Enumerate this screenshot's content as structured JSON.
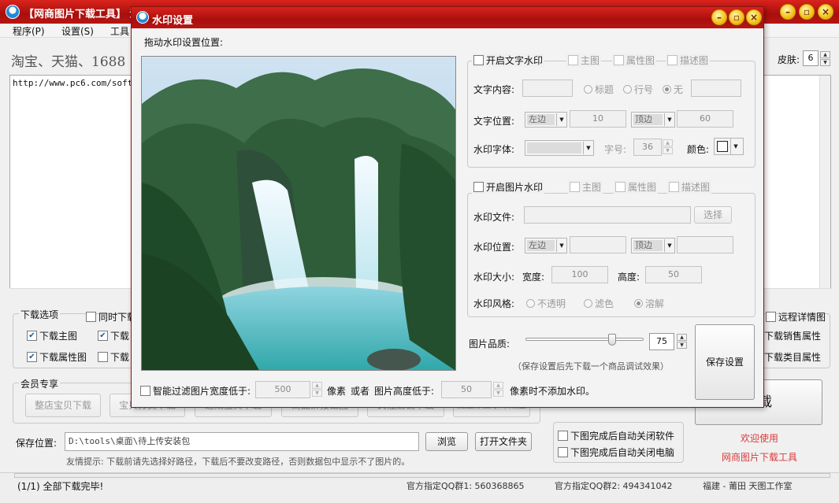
{
  "main": {
    "title": "【网商图片下载工具】 淘宝",
    "menu": [
      "程序(P)",
      "设置(S)",
      "工具"
    ],
    "slogan": "淘宝、天猫、1688",
    "url": "http://www.pc6.com/softvi",
    "skin_label": "皮肤:",
    "skin_value": "6",
    "download_options": {
      "title": "下载选项",
      "items": [
        "同时下载",
        "下载主图",
        "下载",
        "下载属性图",
        "下载"
      ],
      "right_items": [
        "远程详情图",
        "下载销售属性",
        "下载类目属性"
      ]
    },
    "member": {
      "title": "会员专享",
      "buttons": [
        "整店宝贝下载",
        "宝贝分类下载",
        "近期宝贝下载",
        "商品拼接截图",
        "关注店铺下载",
        "批量添加水印效应"
      ]
    },
    "save_label": "保存位置:",
    "save_path": "D:\\tools\\桌面\\待上传安装包",
    "browse": "浏览",
    "open_folder": "打开文件夹",
    "tip": "友情提示: 下载前请先选择好路径，下载后不要改变路径，否则数据包中显示不了图片的。",
    "big_download": "下载",
    "auto_close_soft": "下图完成后自动关闭软件",
    "auto_close_pc": "下图完成后自动关闭电脑",
    "welcome": "欢迎使用",
    "app_name": "网商图片下载工具",
    "status": {
      "progress": "(1/1) 全部下载完毕!",
      "qq1": "官方指定QQ群1: 560368865",
      "qq2": "官方指定QQ群2: 494341042",
      "studio": "福建 - 莆田 天图工作室"
    }
  },
  "dialog": {
    "title": "水印设置",
    "drag_hint": "拖动水印设置位置:",
    "text_wm": {
      "enable": "开启文字水印",
      "targets": [
        "主图",
        "属性图",
        "描述图"
      ],
      "content_label": "文字内容:",
      "opt_title": "标题",
      "opt_row": "行号",
      "opt_none": "无",
      "pos_label": "文字位置:",
      "h_align": "左边",
      "h_value": "10",
      "v_align": "顶边",
      "v_value": "60",
      "font_label": "水印字体:",
      "size_label": "字号:",
      "size_value": "36",
      "color_label": "颜色:"
    },
    "image_wm": {
      "enable": "开启图片水印",
      "targets": [
        "主图",
        "属性图",
        "描述图"
      ],
      "file_label": "水印文件:",
      "choose": "选择",
      "pos_label": "水印位置:",
      "h_align": "左边",
      "v_align": "顶边",
      "size_label": "水印大小:",
      "width_label": "宽度:",
      "width_value": "100",
      "height_label": "高度:",
      "height_value": "50",
      "style_label": "水印风格:",
      "style_opts": [
        "不透明",
        "滤色",
        "溶解"
      ]
    },
    "quality_label": "图片品质:",
    "quality_value": "75",
    "quality_fraction": 0.75,
    "save_note": "（保存设置后先下载一个商品调试效果）",
    "save_button": "保存设置",
    "filter": {
      "label": "智能过滤图片宽度低于:",
      "width": "500",
      "px1": "像素",
      "or": "或者",
      "height_label": "图片高度低于:",
      "height": "50",
      "tail": "像素时不添加水印。"
    }
  }
}
